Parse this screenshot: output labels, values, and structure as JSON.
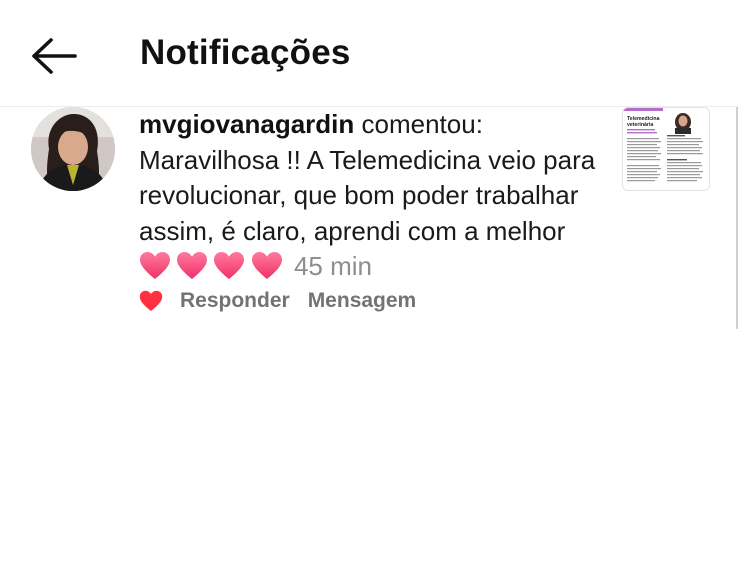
{
  "header": {
    "title": "Notificações",
    "back_icon": "arrow-left-icon"
  },
  "notification": {
    "username": "mvgiovanagardin",
    "action": "comentou:",
    "comment": "Maravilhosa !! A Telemedicina veio para revolucionar, que bom poder trabalhar assim, é claro, aprendi com a melhor",
    "emoji": "❤️❤️❤️❤️",
    "timestamp": "45 min",
    "actions": {
      "like_icon": "heart-filled-icon",
      "reply_label": "Responder",
      "message_label": "Mensagem"
    },
    "thumbnail": {
      "title": "Telemedicina veterinária"
    }
  },
  "colors": {
    "heart_red": "#ff3040",
    "emoji_heart_pink": "#ff4d7a",
    "secondary_text": "#737373",
    "timestamp_text": "#8e8e8e",
    "thumbnail_accent": "#b46ec9"
  }
}
